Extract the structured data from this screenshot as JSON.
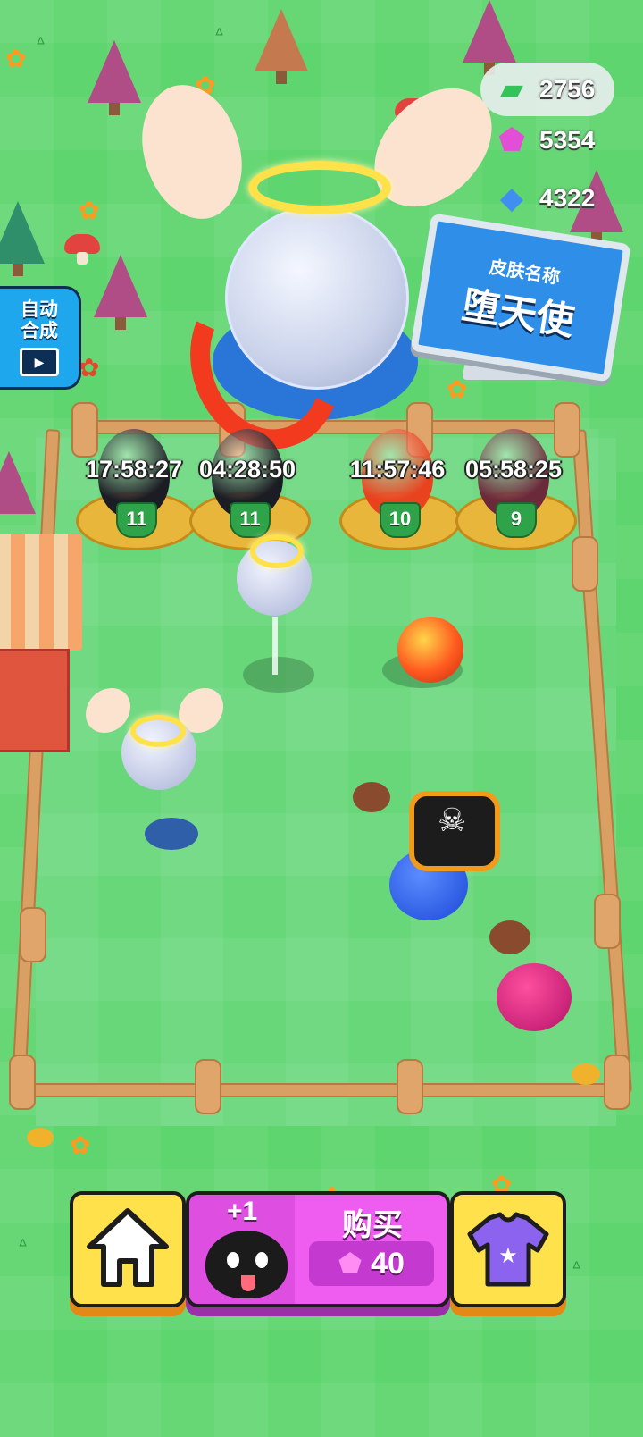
{
  "currencies": [
    {
      "name": "cash",
      "icon": "cash-icon",
      "value": "2756"
    },
    {
      "name": "gem",
      "icon": "gem-icon",
      "value": "5354"
    },
    {
      "name": "diamond",
      "icon": "diamond-icon",
      "value": "4322"
    }
  ],
  "auto_merge": {
    "line1": "自动",
    "line2": "合成",
    "icon": "video-icon"
  },
  "skin_sign": {
    "title": "皮肤名称",
    "name": "堕天使"
  },
  "nests": [
    {
      "timer": "17:58:27",
      "level": "11",
      "egg_color": "#1c1c24"
    },
    {
      "timer": "04:28:50",
      "level": "11",
      "egg_color": "#1c1c24"
    },
    {
      "timer": "11:57:46",
      "level": "10",
      "egg_color": "#e8421f"
    },
    {
      "timer": "05:58:25",
      "level": "9",
      "egg_color": "#6b2a3a"
    }
  ],
  "bottom_bar": {
    "home_icon": "home-icon",
    "buy": {
      "bonus": "+1",
      "label": "购买",
      "price": "40",
      "price_icon": "gem-icon"
    },
    "shirt_icon": "shirt-icon"
  },
  "colors": {
    "grass": "#5fd56f",
    "gem": "#e24fd6",
    "cash": "#33c35a",
    "diamond": "#3f8ef0"
  }
}
